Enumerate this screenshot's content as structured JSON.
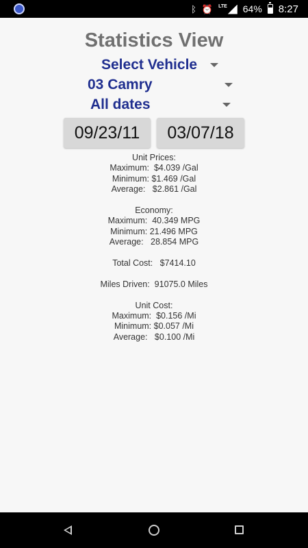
{
  "status_bar": {
    "battery": "64%",
    "time": "8:27",
    "network": "LTE",
    "icons": [
      "app-icon",
      "bluetooth-icon",
      "alarm-icon",
      "signal-icon",
      "battery-icon"
    ]
  },
  "title": "Statistics View",
  "spinners": {
    "select_vehicle": "Select Vehicle",
    "vehicle": "03 Camry",
    "dates": "All dates"
  },
  "dates": {
    "start": "09/23/11",
    "end": "03/07/18"
  },
  "stats": {
    "unit_prices": {
      "heading": "Unit Prices:",
      "maximum": "Maximum:  $4.039 /Gal",
      "minimum": "Minimum: $1.469 /Gal",
      "average": "Average:   $2.861 /Gal"
    },
    "economy": {
      "heading": "Economy:",
      "maximum": "Maximum:  40.349 MPG",
      "minimum": "Minimum: 21.496 MPG",
      "average": "Average:   28.854 MPG"
    },
    "total_cost": "Total Cost:   $7414.10",
    "miles_driven": "Miles Driven:  91075.0 Miles",
    "unit_cost": {
      "heading": "Unit Cost:",
      "maximum": "Maximum:  $0.156 /Mi",
      "minimum": "Minimum: $0.057 /Mi",
      "average": "Average:   $0.100 /Mi"
    }
  },
  "nav_bar": {
    "icons": [
      "back-icon",
      "home-icon",
      "recents-icon"
    ]
  }
}
